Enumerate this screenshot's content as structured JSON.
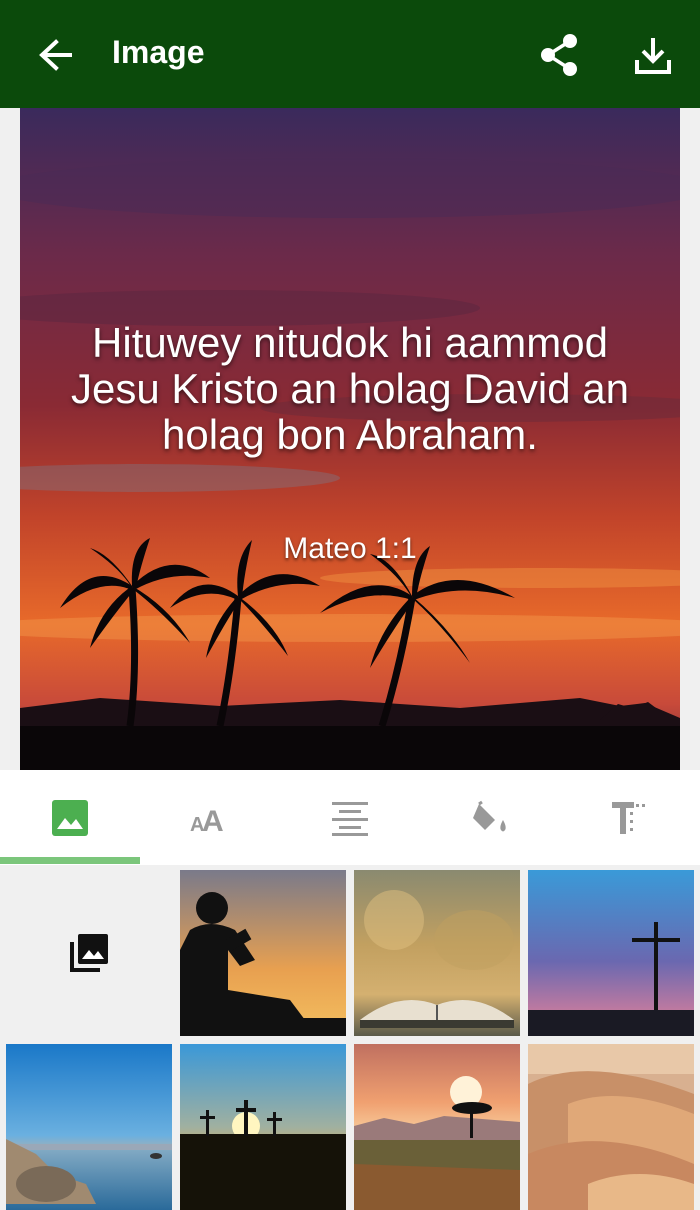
{
  "appbar": {
    "title": "Image",
    "back_icon": "arrow-left-icon",
    "share_icon": "share-icon",
    "download_icon": "download-icon",
    "background": "#0b4a0b"
  },
  "preview": {
    "verse": "Hituwey nitudok hi aammod Jesu Kristo an holag David an holag bon Abraham.",
    "reference": "Mateo 1:1"
  },
  "tabs": [
    {
      "name": "background-image",
      "icon": "image-icon",
      "selected": true
    },
    {
      "name": "font",
      "icon": "font-size-icon",
      "selected": false
    },
    {
      "name": "alignment",
      "icon": "align-center-icon",
      "selected": false
    },
    {
      "name": "color",
      "icon": "paint-bucket-icon",
      "selected": false
    },
    {
      "name": "text-format",
      "icon": "text-format-icon",
      "selected": false
    }
  ],
  "accent": "#7bc67b",
  "gallery": {
    "picker_icon": "photo-library-icon",
    "thumbnails": [
      "child-reading-silhouette",
      "open-bible-blurred",
      "cross-at-dusk",
      "rocky-lake-shore",
      "three-crosses-sunset",
      "acacia-tree-sunset",
      "sand-dunes"
    ]
  }
}
